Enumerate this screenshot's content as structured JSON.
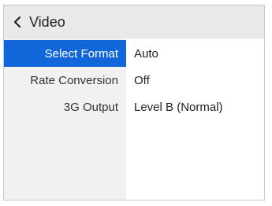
{
  "header": {
    "back_icon": "chevron-left-icon",
    "title": "Video"
  },
  "settings": [
    {
      "label": "Select Format",
      "value": "Auto",
      "selected": true
    },
    {
      "label": "Rate Conversion",
      "value": "Off",
      "selected": false
    },
    {
      "label": "3G Output",
      "value": "Level B (Normal)",
      "selected": false
    }
  ],
  "colors": {
    "selected_bg": "#1167d9",
    "header_bg": "#e9e9e9",
    "label_column_bg": "#f1f1f1"
  }
}
